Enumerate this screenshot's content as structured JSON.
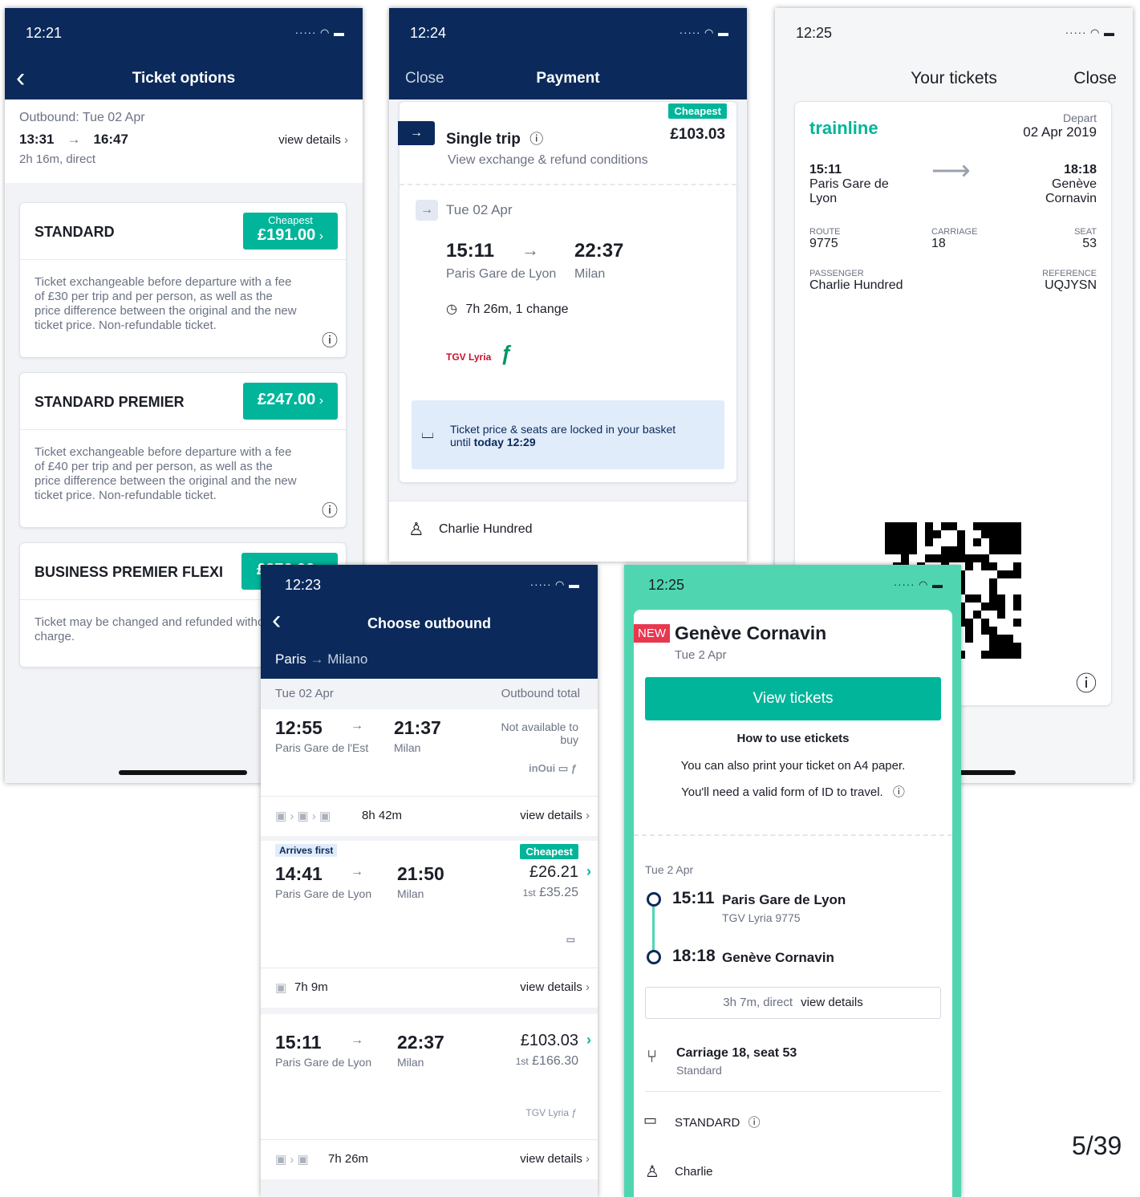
{
  "s1": {
    "time": "12:21",
    "title": "Ticket options",
    "outbound": "Outbound: Tue 02 Apr",
    "dep": "13:31",
    "arr": "16:47",
    "view": "view details",
    "dur": "2h 16m, direct",
    "opts": [
      {
        "name": "STANDARD",
        "badge": "Cheapest",
        "price": "£191.00",
        "desc": "Ticket exchangeable before departure with a fee of £30 per trip and per person, as well as the price difference between the original and the new ticket price. Non-refundable ticket."
      },
      {
        "name": "STANDARD PREMIER",
        "price": "£247.00",
        "desc": "Ticket exchangeable before departure with a fee of £40 per trip and per person, as well as the price difference between the original and the new ticket price. Non-refundable ticket."
      },
      {
        "name": "BUSINESS PREMIER FLEXI",
        "price": "£276.00",
        "desc": "Ticket may be changed and refunded without charge."
      }
    ]
  },
  "s2": {
    "time": "12:24",
    "close": "Close",
    "title": "Payment",
    "badge": "Cheapest",
    "trip": "Single trip",
    "price": "£103.03",
    "cond": "View exchange & refund conditions",
    "date": "Tue 02 Apr",
    "dep": "15:11",
    "arr": "22:37",
    "from": "Paris Gare de Lyon",
    "to": "Milan",
    "dur": "7h 26m, 1 change",
    "lock1": "Ticket price & seats are locked in your basket",
    "lock2": "until",
    "lock3": "today 12:29",
    "passenger": "Charlie Hundred",
    "brand": "TGV Lyria"
  },
  "s3": {
    "time": "12:25",
    "title": "Your tickets",
    "close": "Close",
    "logo": "trainline",
    "depart": "Depart",
    "date": "02 Apr 2019",
    "dep": "15:11",
    "from": "Paris Gare de Lyon",
    "arr": "18:18",
    "to": "Genève Cornavin",
    "route_l": "ROUTE",
    "route": "9775",
    "car_l": "CARRIAGE",
    "car": "18",
    "seat_l": "SEAT",
    "seat": "53",
    "pass_l": "PASSENGER",
    "pass": "Charlie Hundred",
    "ref_l": "REFERENCE",
    "ref": "UQJYSN"
  },
  "s4": {
    "time": "12:23",
    "title": "Choose outbound",
    "from": "Paris",
    "to": "Milano",
    "date": "Tue 02 Apr",
    "total": "Outbound total",
    "j1": {
      "dep": "12:55",
      "arr": "21:37",
      "from": "Paris Gare de l'Est",
      "to": "Milan",
      "status": "Not available to buy",
      "dur": "8h 42m",
      "view": "view details"
    },
    "j2": {
      "tag": "Arrives first",
      "badge": "Cheapest",
      "dep": "14:41",
      "arr": "21:50",
      "from": "Paris Gare de Lyon",
      "to": "Milan",
      "price": "£26.21",
      "first": "1st",
      "fprice": "£35.25",
      "dur": "7h 9m",
      "view": "view details"
    },
    "j3": {
      "dep": "15:11",
      "arr": "22:37",
      "from": "Paris Gare de Lyon",
      "to": "Milan",
      "price": "£103.03",
      "first": "1st",
      "fprice": "£166.30",
      "dur": "7h 26m",
      "view": "view details"
    }
  },
  "s5": {
    "time": "12:25",
    "new": "NEW",
    "dest": "Genève Cornavin",
    "date": "Tue 2 Apr",
    "btn": "View tickets",
    "howto": "How to use etickets",
    "l1": "You can also print your ticket on A4 paper.",
    "l2": "You'll need a valid form of ID to travel.",
    "jdate": "Tue 2 Apr",
    "dep": "15:11",
    "from": "Paris Gare de Lyon",
    "train": "TGV Lyria 9775",
    "arr": "18:18",
    "to": "Genève Cornavin",
    "dur": "3h 7m, direct",
    "view": "view details",
    "seat": "Carriage 18, seat 53",
    "cls": "Standard",
    "fare": "STANDARD",
    "pass": "Charlie"
  },
  "page": "5/39"
}
